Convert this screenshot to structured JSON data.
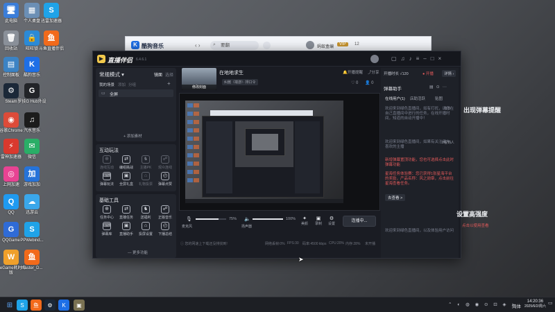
{
  "desktop": {
    "icons": [
      {
        "label": "此电脑",
        "name": "this-pc-icon",
        "color": "#3b7dd8",
        "glyph": "🖥"
      },
      {
        "label": "个人桌盘",
        "name": "personal-disk-icon",
        "color": "#6b8fb5",
        "glyph": "▦"
      },
      {
        "label": "迅雷加速器",
        "name": "xunlei-accelerator-icon",
        "color": "#1fa3e8",
        "glyph": "S"
      },
      {
        "label": "回收站",
        "name": "recycle-bin-icon",
        "color": "#8a9099",
        "glyph": "🗑"
      },
      {
        "label": "旺旺锁",
        "name": "lock-app-icon",
        "color": "#2b8ad6",
        "glyph": "🔒"
      },
      {
        "label": "斗鱼直播伴侣",
        "name": "douyu-companion-icon",
        "color": "#f26a1b",
        "glyph": "鱼"
      },
      {
        "label": "控制面板",
        "name": "control-panel-icon",
        "color": "#3c83c4",
        "glyph": "▤"
      },
      {
        "label": "酷狗音乐",
        "name": "kugou-music-icon",
        "color": "#1e6fe6",
        "glyph": "K"
      },
      {
        "label": "Steam",
        "name": "steam-icon",
        "color": "#1b2838",
        "glyph": "⚙"
      },
      {
        "label": "罗技G Hub外设",
        "name": "logitech-ghub-icon",
        "color": "#222428",
        "glyph": "G"
      },
      {
        "label": "谷歌Chrome",
        "name": "chrome-icon",
        "color": "#dd4b39",
        "glyph": "◉"
      },
      {
        "label": "汽水音乐",
        "name": "qishui-music-icon",
        "color": "#1c1c1c",
        "glyph": "♫"
      },
      {
        "label": "雷神加速器",
        "name": "leishen-accelerator-icon",
        "color": "#d9392e",
        "glyph": "⚡"
      },
      {
        "label": "微信",
        "name": "wechat-icon",
        "color": "#2aae67",
        "glyph": "✉"
      },
      {
        "label": "上网加速",
        "name": "net-accelerator-icon",
        "color": "#e84393",
        "glyph": "◎"
      },
      {
        "label": "游戏加加",
        "name": "youxijiajia-icon",
        "color": "#2673d9",
        "glyph": "加"
      },
      {
        "label": "QQ",
        "name": "qq-icon",
        "color": "#1f9af0",
        "glyph": "Q"
      },
      {
        "label": "迅游云",
        "name": "xunyou-cloud-icon",
        "color": "#3aa7ea",
        "glyph": "☁"
      },
      {
        "label": "QQGame",
        "name": "qqgame-icon",
        "color": "#2f6bd6",
        "glyph": "G"
      },
      {
        "label": "PPWebind...",
        "name": "ppweb-icon",
        "color": "#1fa3e8",
        "glyph": "S"
      },
      {
        "label": "WeGame耗时专版",
        "name": "wegame-icon",
        "color": "#f0a02b",
        "glyph": "W"
      },
      {
        "label": "master_D...",
        "name": "master-file-icon",
        "color": "#f26a1b",
        "glyph": "鱼"
      }
    ]
  },
  "kugou": {
    "title": "酷狗音乐",
    "search_placeholder": "要翻",
    "user": "蚂蚁盒编",
    "vip": "VIP",
    "badge": "12"
  },
  "app": {
    "title": "直播伴侣",
    "version": "6.4.6.1",
    "mode": "常规模式",
    "tab_scene": "镜面",
    "tab_select": "选择",
    "scene_tab": "我的场景",
    "scene_tab2": "添加",
    "scene_tab3": "分组",
    "scene_item": "全屏",
    "add_material": "+ 添加素材",
    "stream_title": "在地地求生",
    "stream_cover": "修改封面",
    "game_tag": "纠酱（端游）· 排口令",
    "likes": "0",
    "viewers": "0",
    "btn_open": "开播提醒",
    "btn_share": "分享",
    "interactive": "互动玩法",
    "interactive_tools": [
      {
        "label": "连线互动",
        "dim": true
      },
      {
        "label": "编组挑战"
      },
      {
        "label": "主播PK",
        "dim": true
      },
      {
        "label": "观众连线",
        "dim": true
      },
      {
        "label": "弹幕玩法"
      },
      {
        "label": "全屏礼盒"
      },
      {
        "label": "礼物投票",
        "dim": true
      },
      {
        "label": "弹幕点赞"
      }
    ],
    "basic": "基础工具",
    "basic_tools": [
      {
        "label": "任务中心"
      },
      {
        "label": "直播任务"
      },
      {
        "label": "送福利"
      },
      {
        "label": "正版音乐"
      },
      {
        "label": "弹幕库"
      },
      {
        "label": "直播助手"
      },
      {
        "label": "投屏设置"
      },
      {
        "label": "下播总结"
      }
    ],
    "more": "— 更多功能",
    "mic_label": "麦克风",
    "mic_pct": "75%",
    "mic_level": 0.75,
    "spk_label": "扬声器",
    "spk_pct": "100%",
    "spk_level": 1.0,
    "beauty": "美颜",
    "record": "录制",
    "settings": "设置",
    "live_btn": "连播中...",
    "status": {
      "hint": "您的网速上下载还没排找到!",
      "drop": "网络丢帧:0%",
      "fps": "FPS:30",
      "bitrate": "码率:4500 kbps",
      "cpu": "CPU:20%",
      "mem": "内存:28%",
      "duration": "未开播"
    }
  },
  "right": {
    "title": "弹幕助手",
    "pill1": "开播时长",
    "pill2": "√120",
    "ext": "详情",
    "tabs": [
      "在线用户(1)",
      "店助活跃",
      "贴图"
    ],
    "msg1": "欢迎来到绿色直播间，如有打扰，请您在自己直播间中进行的任务，在线开播时间，知道的自动开播中！",
    "msg1_count": "0.0",
    "msg2": "欢迎来到绿色直播间，如果有关注用户、喜欢的主播",
    "msg2_note": "0看到人",
    "notice1": "新增弹幕置顶功能，您也可选择点击此时弹幕功能",
    "notice2": "星海任务体验赛：您已获得1张星海平台的奖励，产品名称：风之勋章，点击前往星海查看任务。",
    "go": "去查看 >",
    "msg3": "欢迎来到绿色直播间，以及体验用户访问"
  },
  "overlay": {
    "text1": "出现弹幕提醒",
    "text2": "设置高强度",
    "text3": "点击以使用查看"
  },
  "taskbar": {
    "time": "14:20:36",
    "date": "2025/6/2/周六",
    "lang": "简体"
  }
}
